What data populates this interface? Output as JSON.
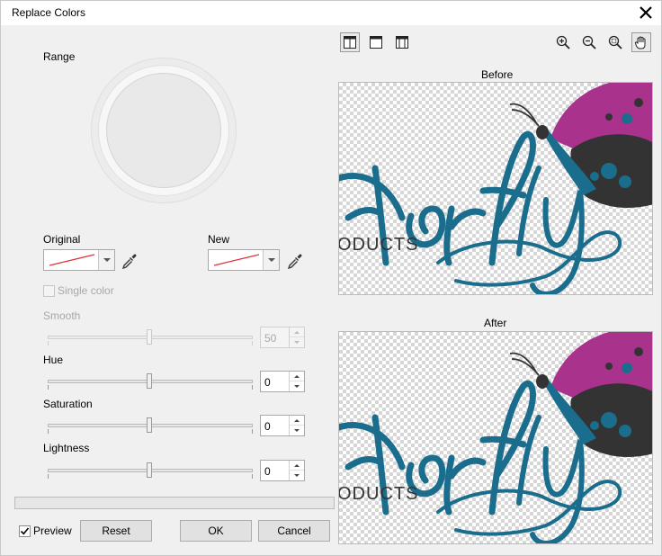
{
  "window": {
    "title": "Replace Colors"
  },
  "left": {
    "range_label": "Range",
    "original_label": "Original",
    "new_label": "New",
    "single_color_label": "Single color",
    "single_color_checked": false,
    "smooth_label": "Smooth",
    "smooth_value": "50",
    "hue_label": "Hue",
    "hue_value": "0",
    "saturation_label": "Saturation",
    "saturation_value": "0",
    "lightness_label": "Lightness",
    "lightness_value": "0",
    "swatch_color": "#e03030"
  },
  "footer": {
    "preview_label": "Preview",
    "preview_checked": true,
    "reset_label": "Reset",
    "ok_label": "OK",
    "cancel_label": "Cancel"
  },
  "preview": {
    "before_label": "Before",
    "after_label": "After",
    "artwork_text": "terfly",
    "artwork_subtext": "ODUCTS",
    "teal_color": "#1a6d8c",
    "magenta_color": "#a8328c"
  },
  "toolbar": {
    "icons": [
      "split-view-icon",
      "single-view-icon",
      "full-view-icon",
      "zoom-in-icon",
      "zoom-out-icon",
      "zoom-fit-icon",
      "hand-pan-icon"
    ]
  }
}
